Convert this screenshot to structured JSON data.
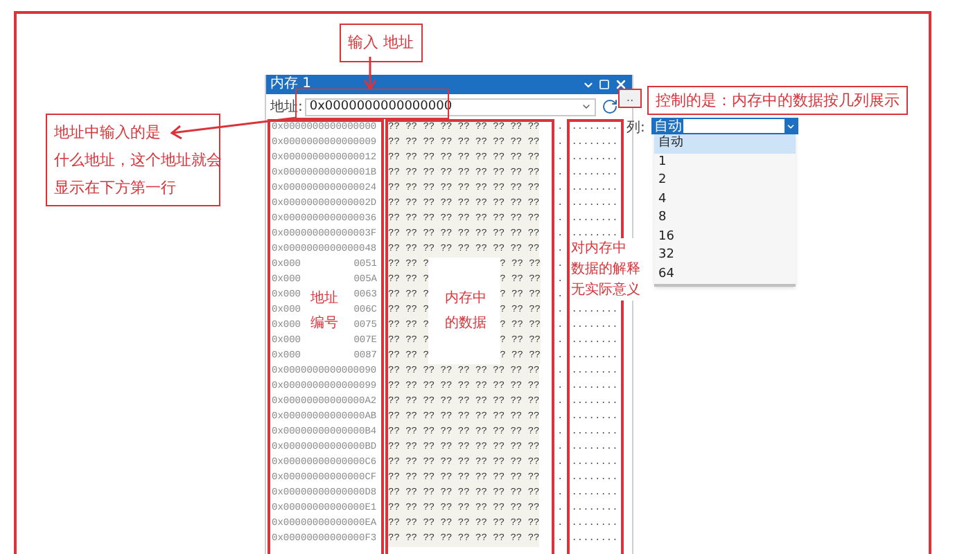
{
  "memory_window": {
    "title": "内存 1",
    "address_label": "地址:",
    "address_value": "0x0000000000000000",
    "options_button": "‥",
    "rows": [
      {
        "kind": "full",
        "address": "0x0000000000000000",
        "bytes": "?? ?? ?? ?? ?? ?? ?? ?? ??",
        "dot": ".",
        "ascii": "........"
      },
      {
        "kind": "full",
        "address": "0x0000000000000009",
        "bytes": "?? ?? ?? ?? ?? ?? ?? ?? ??",
        "dot": ".",
        "ascii": "........"
      },
      {
        "kind": "full",
        "address": "0x0000000000000012",
        "bytes": "?? ?? ?? ?? ?? ?? ?? ?? ??",
        "dot": ".",
        "ascii": "........"
      },
      {
        "kind": "full",
        "address": "0x000000000000001B",
        "bytes": "?? ?? ?? ?? ?? ?? ?? ?? ??",
        "dot": ".",
        "ascii": "........"
      },
      {
        "kind": "full",
        "address": "0x0000000000000024",
        "bytes": "?? ?? ?? ?? ?? ?? ?? ?? ??",
        "dot": ".",
        "ascii": "........"
      },
      {
        "kind": "full",
        "address": "0x000000000000002D",
        "bytes": "?? ?? ?? ?? ?? ?? ?? ?? ??",
        "dot": ".",
        "ascii": "........"
      },
      {
        "kind": "full",
        "address": "0x0000000000000036",
        "bytes": "?? ?? ?? ?? ?? ?? ?? ?? ??",
        "dot": ".",
        "ascii": "........"
      },
      {
        "kind": "full",
        "address": "0x000000000000003F",
        "bytes": "?? ?? ?? ?? ?? ?? ?? ?? ??",
        "dot": ".",
        "ascii": "........"
      },
      {
        "kind": "full",
        "address": "0x0000000000000048",
        "bytes": "?? ?? ?? ?? ?? ?? ?? ?? ??",
        "dot": "."
      },
      {
        "kind": "split",
        "address_parts": [
          "0x000",
          "0051"
        ],
        "byte_parts": [
          "?? ?? ?",
          "? ?? ??"
        ],
        "dot": "."
      },
      {
        "kind": "split",
        "address_parts": [
          "0x000",
          "005A"
        ],
        "byte_parts": [
          "?? ?? ?",
          "? ?? ??"
        ],
        "dot": "."
      },
      {
        "kind": "split",
        "address_parts": [
          "0x000",
          "0063"
        ],
        "byte_parts": [
          "?? ?? ?",
          "? ?? ??"
        ],
        "dot": "."
      },
      {
        "kind": "split",
        "address_parts": [
          "0x000",
          "006C"
        ],
        "byte_parts": [
          "?? ?? ?",
          "? ?? ??"
        ],
        "dot": ".",
        "ascii": "........"
      },
      {
        "kind": "split",
        "address_parts": [
          "0x000",
          "0075"
        ],
        "byte_parts": [
          "?? ?? ?",
          "? ?? ??"
        ],
        "dot": ".",
        "ascii": "........"
      },
      {
        "kind": "split",
        "address_parts": [
          "0x000",
          "007E"
        ],
        "byte_parts": [
          "?? ?? ?",
          "? ?? ??"
        ],
        "dot": ".",
        "ascii": "........"
      },
      {
        "kind": "split",
        "address_parts": [
          "0x000",
          "0087"
        ],
        "byte_parts": [
          "?? ?? ?",
          "? ?? ??"
        ],
        "dot": ".",
        "ascii": "........"
      },
      {
        "kind": "full",
        "address": "0x0000000000000090",
        "bytes": "?? ?? ?? ?? ?? ?? ?? ?? ??",
        "dot": ".",
        "ascii": "........"
      },
      {
        "kind": "full",
        "address": "0x0000000000000099",
        "bytes": "?? ?? ?? ?? ?? ?? ?? ?? ??",
        "dot": ".",
        "ascii": "........"
      },
      {
        "kind": "full",
        "address": "0x00000000000000A2",
        "bytes": "?? ?? ?? ?? ?? ?? ?? ?? ??",
        "dot": ".",
        "ascii": "........"
      },
      {
        "kind": "full",
        "address": "0x00000000000000AB",
        "bytes": "?? ?? ?? ?? ?? ?? ?? ?? ??",
        "dot": ".",
        "ascii": "........"
      },
      {
        "kind": "full",
        "address": "0x00000000000000B4",
        "bytes": "?? ?? ?? ?? ?? ?? ?? ?? ??",
        "dot": ".",
        "ascii": "........"
      },
      {
        "kind": "full",
        "address": "0x00000000000000BD",
        "bytes": "?? ?? ?? ?? ?? ?? ?? ?? ??",
        "dot": ".",
        "ascii": "........"
      },
      {
        "kind": "full",
        "address": "0x00000000000000C6",
        "bytes": "?? ?? ?? ?? ?? ?? ?? ?? ??",
        "dot": ".",
        "ascii": "........"
      },
      {
        "kind": "full",
        "address": "0x00000000000000CF",
        "bytes": "?? ?? ?? ?? ?? ?? ?? ?? ??",
        "dot": ".",
        "ascii": "........"
      },
      {
        "kind": "full",
        "address": "0x00000000000000D8",
        "bytes": "?? ?? ?? ?? ?? ?? ?? ?? ??",
        "dot": ".",
        "ascii": "........"
      },
      {
        "kind": "full",
        "address": "0x00000000000000E1",
        "bytes": "?? ?? ?? ?? ?? ?? ?? ?? ??",
        "dot": ".",
        "ascii": "........"
      },
      {
        "kind": "full",
        "address": "0x00000000000000EA",
        "bytes": "?? ?? ?? ?? ?? ?? ?? ?? ??",
        "dot": ".",
        "ascii": "........"
      },
      {
        "kind": "full",
        "address": "0x00000000000000F3",
        "bytes": "?? ?? ?? ?? ?? ?? ?? ?? ??",
        "dot": ".",
        "ascii": "........"
      }
    ],
    "overlay_labels": [
      {
        "lines": [
          "地址",
          "编号"
        ]
      },
      {
        "lines": [
          "内存中",
          "的数据"
        ]
      }
    ]
  },
  "columns_menu": {
    "label": "列:",
    "value": "自动",
    "items": [
      {
        "label": "自动",
        "selected": true
      },
      {
        "label": "1",
        "selected": false
      },
      {
        "label": "2",
        "selected": false
      },
      {
        "label": "4",
        "selected": false
      },
      {
        "label": "8",
        "selected": false
      },
      {
        "label": "16",
        "selected": false
      },
      {
        "label": "32",
        "selected": false
      },
      {
        "label": "64",
        "selected": false
      }
    ]
  },
  "annotations": [
    {
      "kind": "boxed",
      "lines": [
        "输入 地址"
      ]
    },
    {
      "kind": "boxed",
      "lines": [
        "地址中输入的是",
        "什么地址，这个地址就会",
        "显示在下方第一行"
      ]
    },
    {
      "kind": "boxed",
      "lines": [
        "控制的是：内存中的数据按几列展示"
      ]
    },
    {
      "kind": "plain",
      "lines": [
        "对内存中",
        "数据的解释",
        "无实际意义"
      ]
    }
  ]
}
